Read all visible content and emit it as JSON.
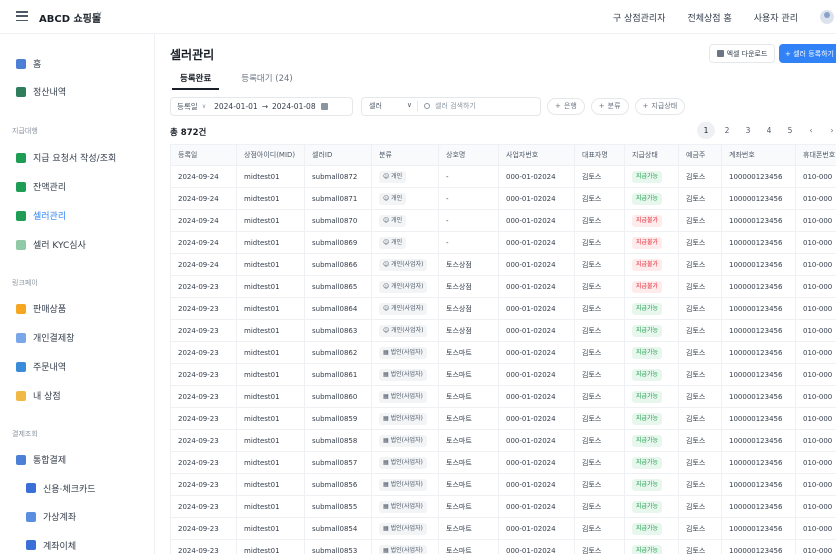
{
  "header": {
    "brand": "ABCD 쇼핑몰",
    "nav": [
      "구 상점관리자",
      "전체상점 홈",
      "사용자 관리"
    ]
  },
  "sidebar": {
    "items": [
      {
        "label": "홈",
        "icon": "home-icon",
        "color": "#4e7fd6"
      },
      {
        "label": "정산내역",
        "icon": "ledger-icon",
        "color": "#2e7d5b"
      }
    ],
    "section1": "지급대행",
    "section1_items": [
      {
        "label": "지급 요청서 작성/조회",
        "icon": "money-icon",
        "color": "#1f9d55"
      },
      {
        "label": "잔액관리",
        "icon": "wallet-icon",
        "color": "#1f9d55"
      },
      {
        "label": "셀러관리",
        "icon": "seller-icon",
        "color": "#1f9d55",
        "active": true
      },
      {
        "label": "셀러 KYC심사",
        "icon": "kyc-icon",
        "color": "#8fc9a6"
      }
    ],
    "section2": "링크페이",
    "section2_items": [
      {
        "label": "판매상품",
        "icon": "product-icon",
        "color": "#f5a623"
      },
      {
        "label": "개인결제창",
        "icon": "personal-pay-icon",
        "color": "#79a7e8"
      },
      {
        "label": "주문내역",
        "icon": "order-icon",
        "color": "#3a8bd8"
      },
      {
        "label": "내 상점",
        "icon": "store-icon",
        "color": "#f0b945"
      }
    ],
    "section3": "결제조회",
    "section3_items": [
      {
        "label": "통합결제",
        "icon": "integrated-pay-icon",
        "color": "#4e7fd6"
      },
      {
        "label": "신용·체크카드",
        "icon": "card-icon",
        "color": "#3a6fd8",
        "sub": true
      },
      {
        "label": "가상계좌",
        "icon": "virtual-account-icon",
        "color": "#5b8ee0",
        "sub": true
      },
      {
        "label": "계좌이체",
        "icon": "transfer-icon",
        "color": "#3a6fd8",
        "sub": true
      }
    ]
  },
  "main": {
    "title": "셀러관리",
    "excel_button": "엑셀 다운로드",
    "register_button": "+ 셀러 등록하기",
    "tabs": [
      "등록완료",
      "등록대기 (24)"
    ],
    "filter": {
      "date_label": "등록일",
      "date_start": "2024-01-01",
      "date_arrow": "→",
      "date_end": "2024-01-08",
      "search_select": "셀러",
      "search_placeholder": "셀러 검색하기",
      "chips": [
        "은행",
        "분류",
        "지급상태"
      ]
    },
    "total": "총 872건",
    "pages": [
      "1",
      "2",
      "3",
      "4",
      "5",
      "‹",
      "›"
    ],
    "columns": [
      "등록일",
      "상점아이디(MID)",
      "셀러ID",
      "분류",
      "상호명",
      "사업자번호",
      "대표자명",
      "지급상태",
      "예금주",
      "계좌번호",
      "휴대폰번호"
    ],
    "rows": [
      [
        "2024-09-24",
        "midtest01",
        "submall0872",
        "개인",
        "-",
        "000-01-02024",
        "김토스",
        "지급가능",
        "김토스",
        "100000123456",
        "010-000"
      ],
      [
        "2024-09-24",
        "midtest01",
        "submall0871",
        "개인",
        "-",
        "000-01-02024",
        "김토스",
        "지급가능",
        "김토스",
        "100000123456",
        "010-000"
      ],
      [
        "2024-09-24",
        "midtest01",
        "submall0870",
        "개인",
        "-",
        "000-01-02024",
        "김토스",
        "지급불가",
        "김토스",
        "100000123456",
        "010-000"
      ],
      [
        "2024-09-24",
        "midtest01",
        "submall0869",
        "개인",
        "-",
        "000-01-02024",
        "김토스",
        "지급불가",
        "김토스",
        "100000123456",
        "010-000"
      ],
      [
        "2024-09-24",
        "midtest01",
        "submall0866",
        "개인(사업자)",
        "토스상점",
        "000-01-02024",
        "김토스",
        "지급불가",
        "김토스",
        "100000123456",
        "010-000"
      ],
      [
        "2024-09-23",
        "midtest01",
        "submall0865",
        "개인(사업자)",
        "토스상점",
        "000-01-02024",
        "김토스",
        "지급불가",
        "김토스",
        "100000123456",
        "010-000"
      ],
      [
        "2024-09-23",
        "midtest01",
        "submall0864",
        "개인(사업자)",
        "토스상점",
        "000-01-02024",
        "김토스",
        "지급가능",
        "김토스",
        "100000123456",
        "010-000"
      ],
      [
        "2024-09-23",
        "midtest01",
        "submall0863",
        "개인(사업자)",
        "토스상점",
        "000-01-02024",
        "김토스",
        "지급가능",
        "김토스",
        "100000123456",
        "010-000"
      ],
      [
        "2024-09-23",
        "midtest01",
        "submall0862",
        "법인(사업자)",
        "토스마트",
        "000-01-02024",
        "김토스",
        "지급가능",
        "김토스",
        "100000123456",
        "010-000"
      ],
      [
        "2024-09-23",
        "midtest01",
        "submall0861",
        "법인(사업자)",
        "토스마트",
        "000-01-02024",
        "김토스",
        "지급가능",
        "김토스",
        "100000123456",
        "010-000"
      ],
      [
        "2024-09-23",
        "midtest01",
        "submall0860",
        "법인(사업자)",
        "토스마트",
        "000-01-02024",
        "김토스",
        "지급가능",
        "김토스",
        "100000123456",
        "010-000"
      ],
      [
        "2024-09-23",
        "midtest01",
        "submall0859",
        "법인(사업자)",
        "토스마트",
        "000-01-02024",
        "김토스",
        "지급가능",
        "김토스",
        "100000123456",
        "010-000"
      ],
      [
        "2024-09-23",
        "midtest01",
        "submall0858",
        "법인(사업자)",
        "토스마트",
        "000-01-02024",
        "김토스",
        "지급가능",
        "김토스",
        "100000123456",
        "010-000"
      ],
      [
        "2024-09-23",
        "midtest01",
        "submall0857",
        "법인(사업자)",
        "토스마트",
        "000-01-02024",
        "김토스",
        "지급가능",
        "김토스",
        "100000123456",
        "010-000"
      ],
      [
        "2024-09-23",
        "midtest01",
        "submall0856",
        "법인(사업자)",
        "토스마트",
        "000-01-02024",
        "김토스",
        "지급가능",
        "김토스",
        "100000123456",
        "010-000"
      ],
      [
        "2024-09-23",
        "midtest01",
        "submall0855",
        "법인(사업자)",
        "토스마트",
        "000-01-02024",
        "김토스",
        "지급가능",
        "김토스",
        "100000123456",
        "010-000"
      ],
      [
        "2024-09-23",
        "midtest01",
        "submall0854",
        "법인(사업자)",
        "토스마트",
        "000-01-02024",
        "김토스",
        "지급가능",
        "김토스",
        "100000123456",
        "010-000"
      ],
      [
        "2024-09-23",
        "midtest01",
        "submall0853",
        "법인(사업자)",
        "토스마트",
        "000-01-02024",
        "김토스",
        "지급가능",
        "김토스",
        "100000123456",
        "010-000"
      ]
    ]
  }
}
